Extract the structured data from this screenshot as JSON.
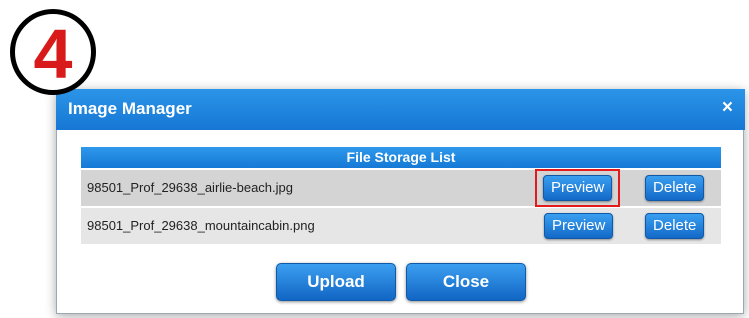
{
  "step": {
    "number": "4"
  },
  "dialog": {
    "title": "Image Manager",
    "close_icon": "×",
    "list_header": "File Storage List",
    "files": [
      {
        "name": "98501_Prof_29638_airlie-beach.jpg",
        "preview_label": "Preview",
        "delete_label": "Delete"
      },
      {
        "name": "98501_Prof_29638_mountaincabin.png",
        "preview_label": "Preview",
        "delete_label": "Delete"
      }
    ],
    "upload_label": "Upload",
    "close_label": "Close"
  },
  "colors": {
    "title_bar": "#1a7fdb",
    "button": "#1e7fe0",
    "highlight_border": "#e3191c",
    "step_number": "#d81a1a"
  }
}
